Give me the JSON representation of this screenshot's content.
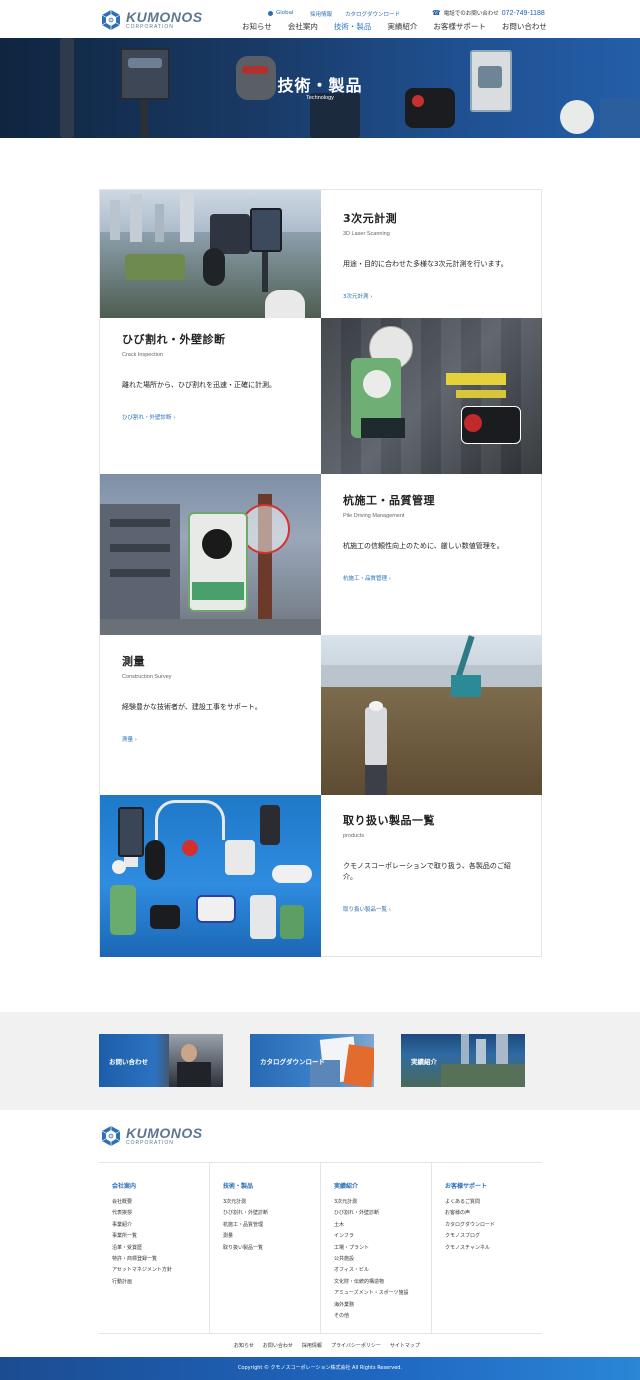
{
  "header": {
    "logo_text": "KUMONOS",
    "logo_sub": "CORPORATION",
    "util": {
      "global": "Global",
      "recruit": "採用情報",
      "catalog": "カタログダウンロード"
    },
    "phone_label": "電話でのお問い合わせ",
    "phone_number": "072-749-1188",
    "nav": [
      "お知らせ",
      "会社案内",
      "技術・製品",
      "実績紹介",
      "お客様サポート",
      "お問い合わせ"
    ],
    "active_nav": "技術・製品"
  },
  "hero": {
    "title": "技術・製品",
    "subtitle": "Technology"
  },
  "services": [
    {
      "title": "3次元計測",
      "en": "3D Laser Scanning",
      "desc": "用途・目的に合わせた多様な3次元計測を行います。",
      "link": "3次元計測"
    },
    {
      "title": "ひび割れ・外壁診断",
      "en": "Crack Inspection",
      "desc": "離れた場所から、ひび割れを迅速・正確に計測。",
      "link": "ひび割れ・外壁診断"
    },
    {
      "title": "杭施工・品質管理",
      "en": "Pile Driving Management",
      "desc": "杭施工の信頼性向上のために、厳しい数値管理を。",
      "link": "杭施工・品質管理"
    },
    {
      "title": "測量",
      "en": "Construction Survey",
      "desc": "経験豊かな技術者が、建設工事をサポート。",
      "link": "測量"
    },
    {
      "title": "取り扱い製品一覧",
      "en": "products",
      "desc": "クモノスコーポレーションで取り扱う、各製品のご紹介。",
      "link": "取り扱い製品一覧"
    }
  ],
  "banners": [
    "お問い合わせ",
    "カタログダウンロード",
    "実績紹介"
  ],
  "footer": {
    "logo_text": "KUMONOS",
    "logo_sub": "CORPORATION",
    "cols": [
      {
        "title": "会社案内",
        "items": [
          "会社概要",
          "代表挨拶",
          "事業紹介",
          "事業所一覧",
          "沿革・受賞歴",
          "特許・商標登録一覧",
          "アセットマネジメント方針",
          "行動計画"
        ]
      },
      {
        "title": "技術・製品",
        "items": [
          "3次元計測",
          "ひび割れ・外壁診断",
          "杭施工・品質管理",
          "測量",
          "取り扱い製品一覧"
        ]
      },
      {
        "title": "実績紹介",
        "items": [
          "3次元計測",
          "ひび割れ・外壁診断",
          "土木",
          "インフラ",
          "工場・プラント",
          "公共施設",
          "オフィス・ビル",
          "文化財・伝統的構造物",
          "アミューズメント・スポーツ施設",
          "海外業務",
          "その他"
        ]
      },
      {
        "title": "お客様サポート",
        "items": [
          "よくあるご質問",
          "お客様の声",
          "カタログダウンロード",
          "クモノスブログ",
          "クモノスチャンネル"
        ]
      }
    ],
    "subnav": [
      "お知らせ",
      "お問い合わせ",
      "採用情報",
      "プライバシーポリシー",
      "サイトマップ"
    ],
    "copyright": "Copyright © クモノスコーポレーション株式会社 All Rights Reserved."
  }
}
